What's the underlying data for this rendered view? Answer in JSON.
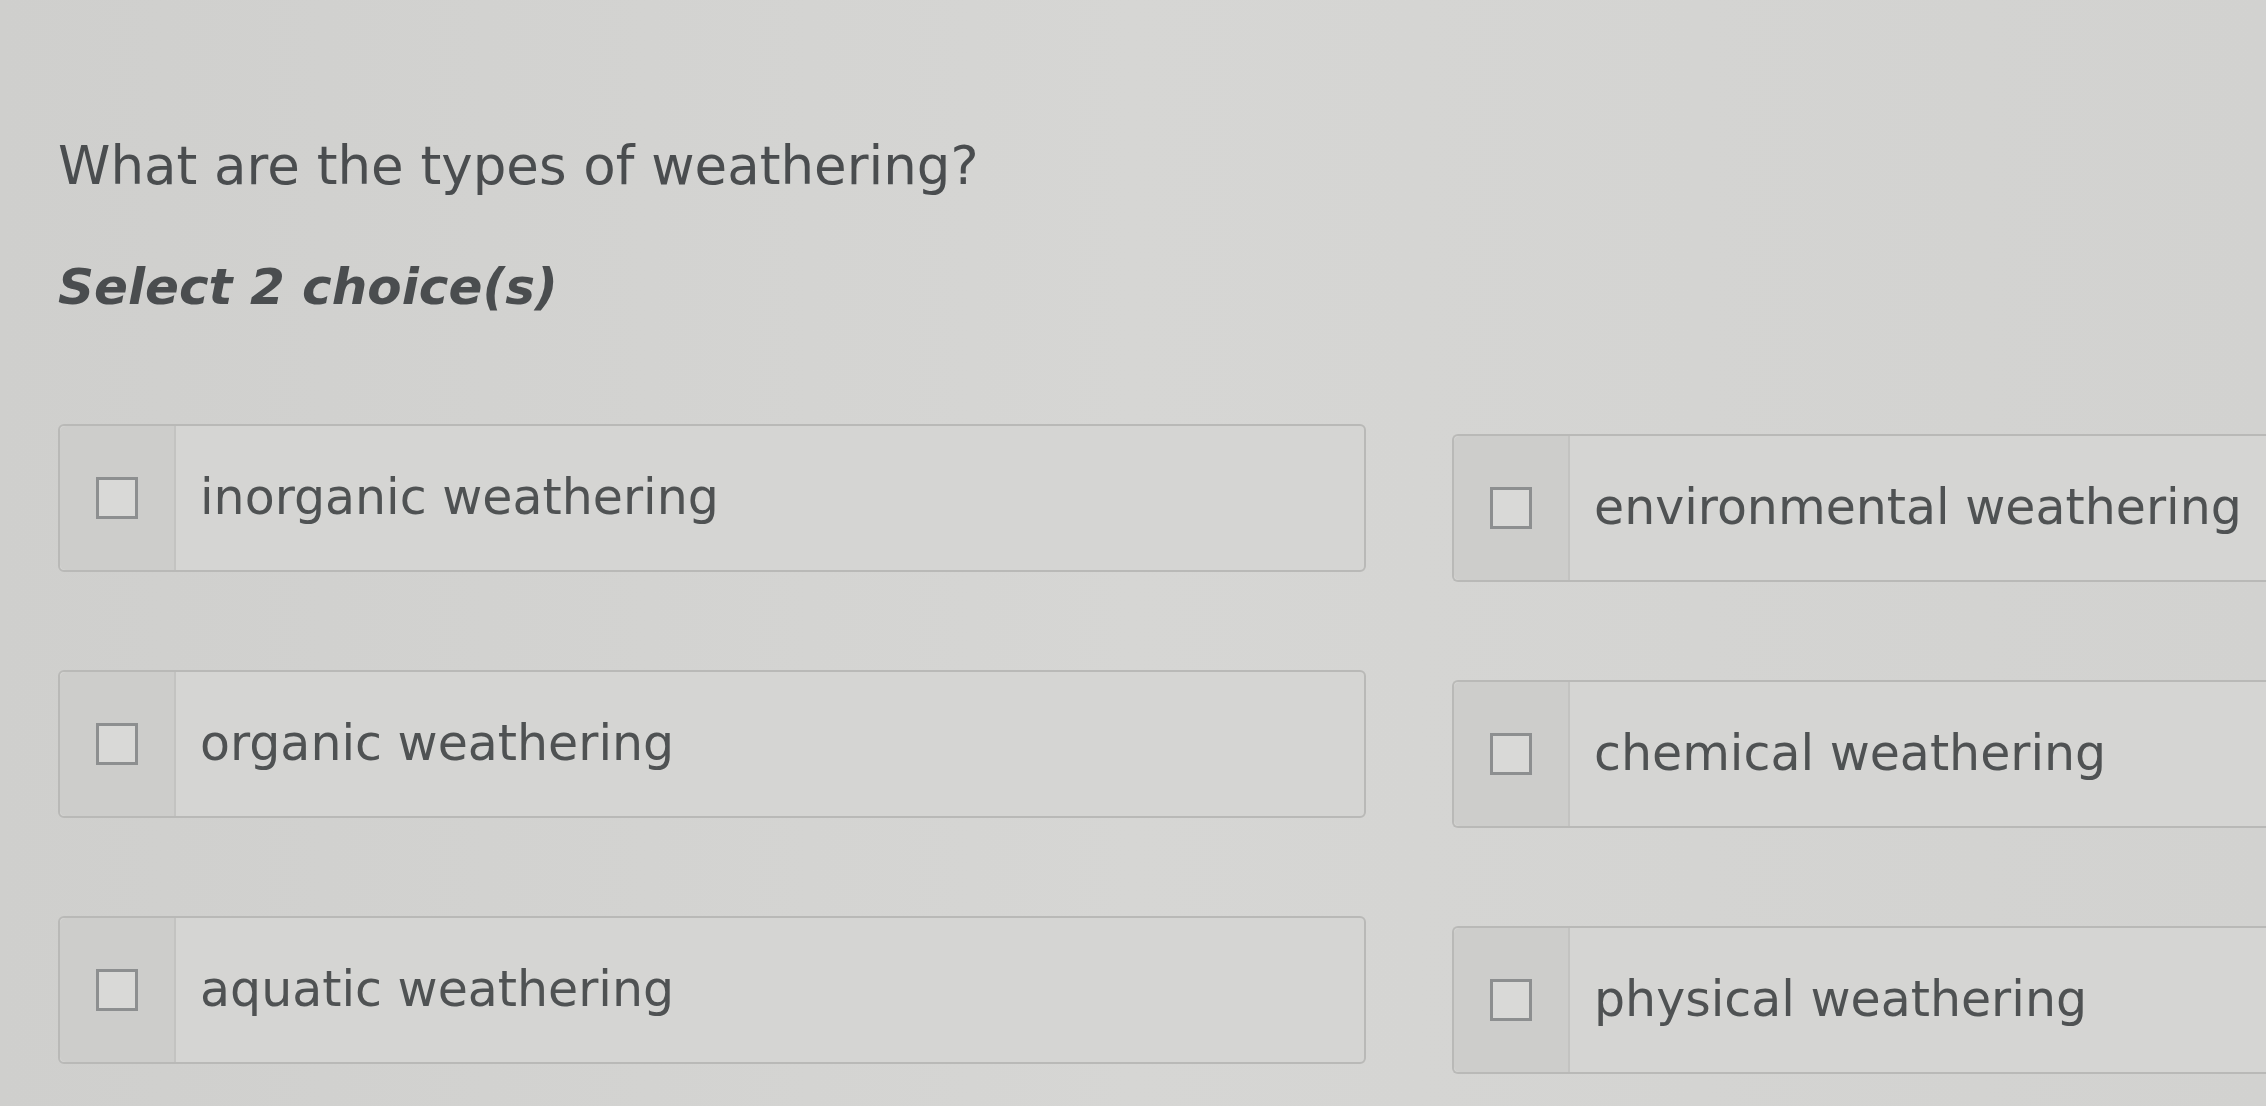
{
  "question": "What are the types of weathering?",
  "instruction": "Select 2 choice(s)",
  "choices": [
    {
      "label": "inorganic weathering",
      "checked": false
    },
    {
      "label": "environmental weathering",
      "checked": false
    },
    {
      "label": "organic weathering",
      "checked": false
    },
    {
      "label": "chemical weathering",
      "checked": false
    },
    {
      "label": "aquatic weathering",
      "checked": false
    },
    {
      "label": "physical weathering",
      "checked": false
    }
  ]
}
